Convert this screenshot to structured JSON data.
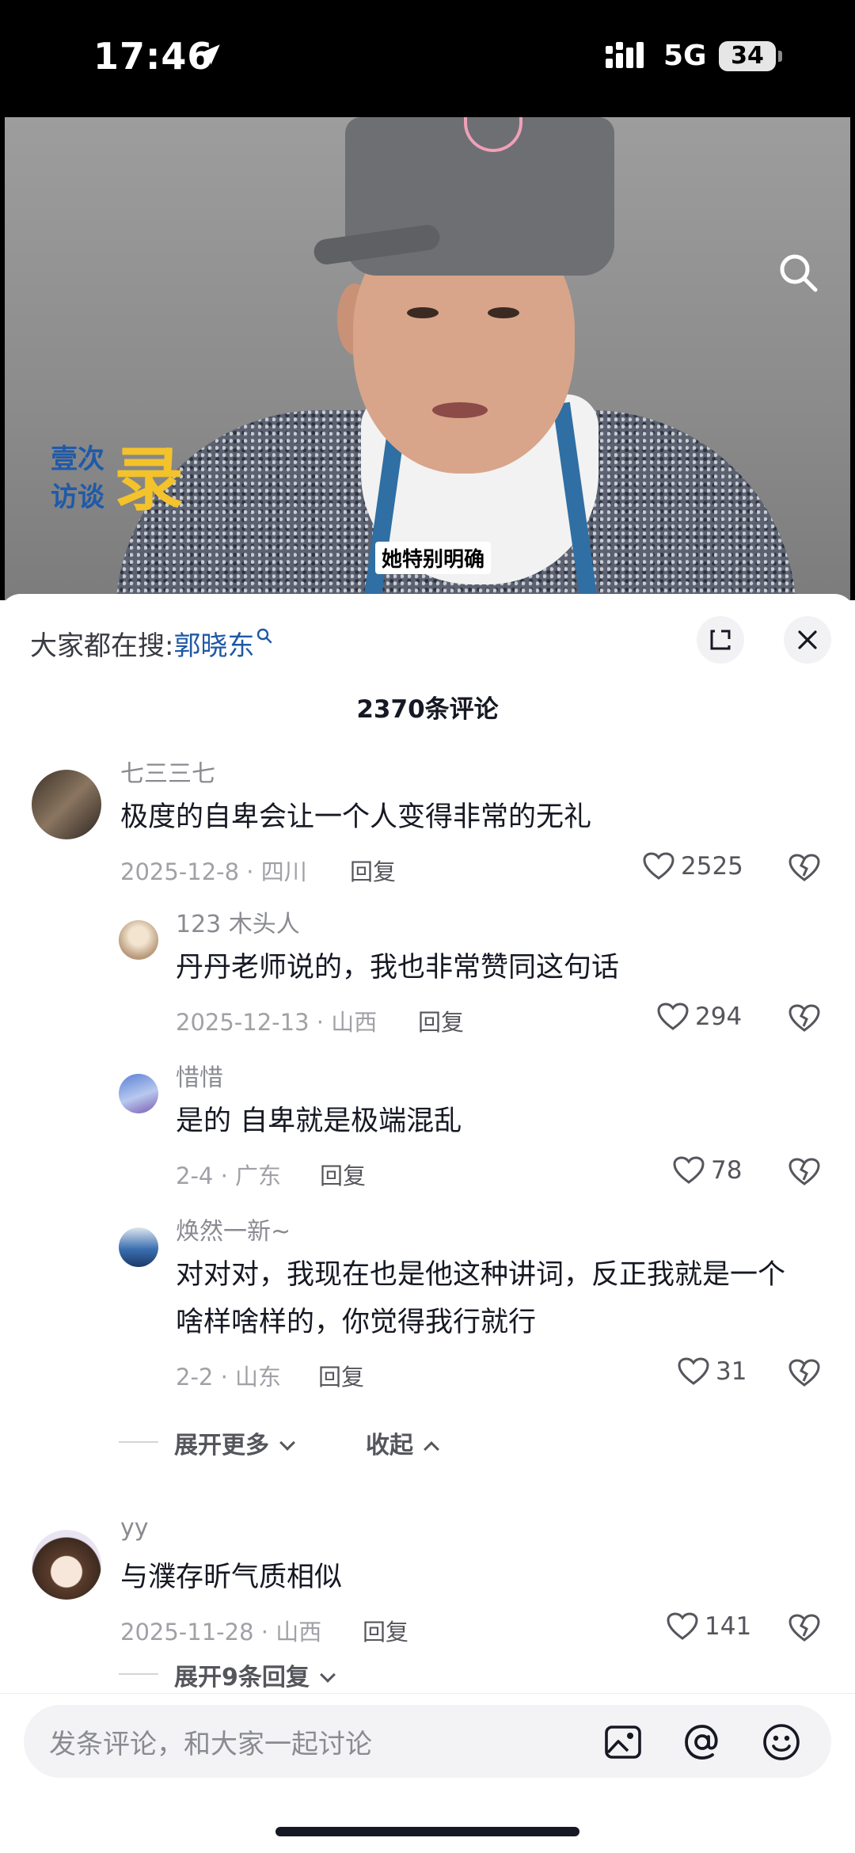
{
  "status_bar": {
    "time": "17:46",
    "network": "5G",
    "battery": "34"
  },
  "video": {
    "brand_line1": "壹次",
    "brand_line2": "访谈",
    "brand_big": "录",
    "caption": "她特别明确"
  },
  "sheet": {
    "trending_label": "大家都在搜:",
    "trending_keyword": "郭晓东",
    "comment_count_title": "2370条评论"
  },
  "comments": [
    {
      "name": "七三三七",
      "lines": [
        "极度的自卑会让一个人变得非常的无礼"
      ],
      "meta": "2025-12-8 · 四川",
      "reply_label": "回复",
      "likes": "2525"
    },
    {
      "name": "123 木头人",
      "lines": [
        "丹丹老师说的，我也非常赞同这句话"
      ],
      "meta": "2025-12-13 · 山西",
      "reply_label": "回复",
      "likes": "294"
    },
    {
      "name": "惜惜",
      "lines": [
        "是的 自卑就是极端混乱"
      ],
      "meta": "2-4 · 广东",
      "reply_label": "回复",
      "likes": "78"
    },
    {
      "name": "焕然一新~",
      "lines": [
        "对对对，我现在也是他这种讲词，反正我就是一个",
        "啥样啥样的，你觉得我行就行"
      ],
      "meta": "2-2 · 山东",
      "reply_label": "回复",
      "likes": "31"
    },
    {
      "name": "yy",
      "lines": [
        "与濮存昕气质相似"
      ],
      "meta": "2025-11-28 · 山西",
      "reply_label": "回复",
      "likes": "141"
    }
  ],
  "thread_controls": {
    "expand_more": "展开更多",
    "collapse": "收起",
    "expand_replies": "展开9条回复"
  },
  "input_bar": {
    "placeholder": "发条评论，和大家一起讨论"
  },
  "icons": {
    "location": "location-arrow-icon",
    "search": "search-icon",
    "expand": "expand-icon",
    "close": "close-icon",
    "like": "heart-outline-icon",
    "dislike": "broken-heart-icon",
    "image": "image-icon",
    "mention": "at-icon",
    "emoji": "emoji-icon"
  }
}
